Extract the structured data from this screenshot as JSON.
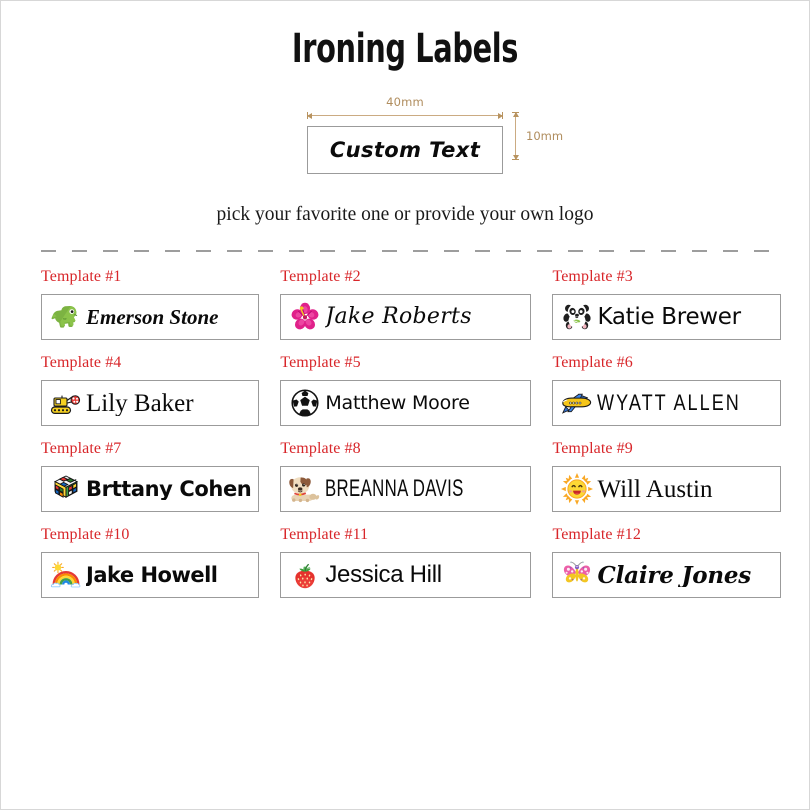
{
  "header": {
    "title": "Ironing Labels"
  },
  "spec": {
    "width_label": "40mm",
    "height_label": "10mm",
    "sample_text": "Custom Text",
    "dimension_color": "#b08d5e"
  },
  "subtitle": "pick your favorite one or provide your own logo",
  "template_label_color": "#d8262a",
  "templates": [
    {
      "label": "Template #1",
      "name": "Emerson Stone",
      "icon": "dinosaur-icon",
      "font": "f-serif-italic"
    },
    {
      "label": "Template #2",
      "name": "Jake Roberts",
      "icon": "hibiscus-icon",
      "font": "f-script"
    },
    {
      "label": "Template #3",
      "name": "Katie Brewer",
      "icon": "panda-icon",
      "font": "f-comic"
    },
    {
      "label": "Template #4",
      "name": "Lily Baker",
      "icon": "bulldozer-icon",
      "font": "f-serif"
    },
    {
      "label": "Template #5",
      "name": "Matthew Moore",
      "icon": "soccer-ball-icon",
      "font": "f-hand"
    },
    {
      "label": "Template #6",
      "name": "WYATT ALLEN",
      "icon": "airplane-icon",
      "font": "f-cond-caps"
    },
    {
      "label": "Template #7",
      "name": "Brttany Cohen",
      "icon": "rubiks-cube-icon",
      "font": "f-bold-round"
    },
    {
      "label": "Template #8",
      "name": "BREANNA DAVIS",
      "icon": "dog-icon",
      "font": "f-cond-caps2"
    },
    {
      "label": "Template #9",
      "name": "Will Austin",
      "icon": "sun-icon",
      "font": "f-serif"
    },
    {
      "label": "Template #10",
      "name": "Jake Howell",
      "icon": "rainbow-icon",
      "font": "f-marker"
    },
    {
      "label": "Template #11",
      "name": "Jessica Hill",
      "icon": "strawberry-icon",
      "font": "f-sans"
    },
    {
      "label": "Template #12",
      "name": "Claire Jones",
      "icon": "butterfly-icon",
      "font": "f-brush"
    }
  ]
}
